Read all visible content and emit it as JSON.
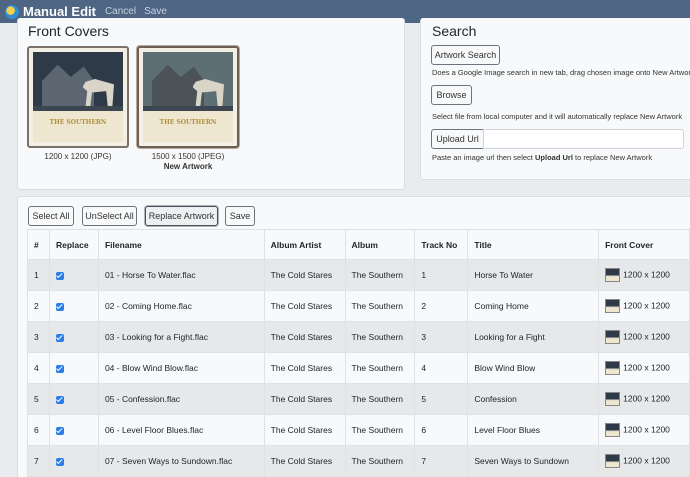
{
  "navbar": {
    "title": "Manual Edit",
    "cancel_label": "Cancel",
    "save_label": "Save",
    "logo_icon": "app-logo-icon"
  },
  "covers": {
    "heading": "Front Covers",
    "items": [
      {
        "logo_text": "THE SOUTHERN",
        "caption": "1200 x 1200 (JPG)",
        "sub": ""
      },
      {
        "logo_text": "THE SOUTHERN",
        "caption": "1500 x 1500 (JPEG)",
        "sub": "New Artwork"
      }
    ]
  },
  "search": {
    "heading": "Search",
    "artwork_search_label": "Artwork Search",
    "artwork_search_hint": "Does a Google Image search in new tab, drag chosen image onto New Artwork",
    "browse_label": "Browse",
    "browse_hint": "Select file from local computer and it will automatically replace New Artwork",
    "upload_url_label": "Upload Url",
    "upload_url_value": "",
    "upload_hint_pre": "Paste an image url then select ",
    "upload_hint_bold": "Upload Url",
    "upload_hint_post": " to replace New Artwork"
  },
  "toolbar": {
    "select_all": "Select All",
    "unselect_all": "UnSelect All",
    "replace_artwork": "Replace Artwork",
    "save": "Save"
  },
  "table": {
    "headers": [
      "#",
      "Replace",
      "Filename",
      "Album Artist",
      "Album",
      "Track No",
      "Title",
      "Front Cover"
    ],
    "rows": [
      {
        "num": "1",
        "checked": true,
        "filename": "01 - Horse To Water.flac",
        "artist": "The Cold Stares",
        "album": "The Southern",
        "track": "1",
        "title": "Horse To Water",
        "cover": "1200 x 1200"
      },
      {
        "num": "2",
        "checked": true,
        "filename": "02 - Coming Home.flac",
        "artist": "The Cold Stares",
        "album": "The Southern",
        "track": "2",
        "title": "Coming Home",
        "cover": "1200 x 1200"
      },
      {
        "num": "3",
        "checked": true,
        "filename": "03 - Looking for a Fight.flac",
        "artist": "The Cold Stares",
        "album": "The Southern",
        "track": "3",
        "title": "Looking for a Fight",
        "cover": "1200 x 1200"
      },
      {
        "num": "4",
        "checked": true,
        "filename": "04 - Blow Wind Blow.flac",
        "artist": "The Cold Stares",
        "album": "The Southern",
        "track": "4",
        "title": "Blow Wind Blow",
        "cover": "1200 x 1200"
      },
      {
        "num": "5",
        "checked": true,
        "filename": "05 - Confession.flac",
        "artist": "The Cold Stares",
        "album": "The Southern",
        "track": "5",
        "title": "Confession",
        "cover": "1200 x 1200"
      },
      {
        "num": "6",
        "checked": true,
        "filename": "06 - Level Floor Blues.flac",
        "artist": "The Cold Stares",
        "album": "The Southern",
        "track": "6",
        "title": "Level Floor Blues",
        "cover": "1200 x 1200"
      },
      {
        "num": "7",
        "checked": true,
        "filename": "07 - Seven Ways to Sundown.flac",
        "artist": "The Cold Stares",
        "album": "The Southern",
        "track": "7",
        "title": "Seven Ways to Sundown",
        "cover": "1200 x 1200"
      }
    ]
  }
}
